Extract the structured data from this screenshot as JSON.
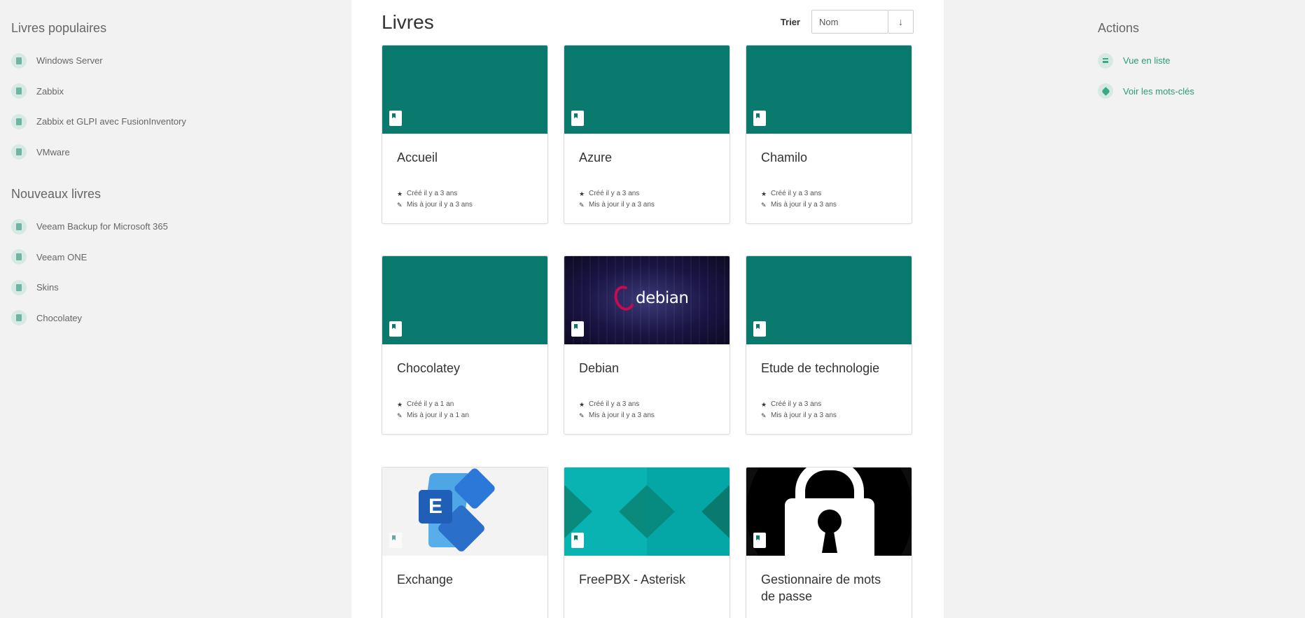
{
  "left_sidebar": {
    "popular_heading": "Livres populaires",
    "popular": [
      "Windows Server",
      "Zabbix",
      "Zabbix et GLPI avec FusionInventory",
      "VMware"
    ],
    "new_heading": "Nouveaux livres",
    "new": [
      "Veeam Backup for Microsoft 365",
      "Veeam ONE",
      "Skins",
      "Chocolatey"
    ]
  },
  "right_sidebar": {
    "heading": "Actions",
    "actions": [
      {
        "label": "Vue en liste",
        "icon": "list-icon"
      },
      {
        "label": "Voir les mots-clés",
        "icon": "tag-icon"
      }
    ]
  },
  "main": {
    "title": "Livres",
    "sort_label": "Trier",
    "sort_value": "Nom",
    "sort_direction": "↓",
    "books": [
      {
        "title": "Accueil",
        "created": "Créé il y a 3 ans",
        "updated": "Mis à jour il y a 3 ans",
        "cover": "teal"
      },
      {
        "title": "Azure",
        "created": "Créé il y a 3 ans",
        "updated": "Mis à jour il y a 3 ans",
        "cover": "teal"
      },
      {
        "title": "Chamilo",
        "created": "Créé il y a 3 ans",
        "updated": "Mis à jour il y a 3 ans",
        "cover": "teal"
      },
      {
        "title": "Chocolatey",
        "created": "Créé il y a 1 an",
        "updated": "Mis à jour il y a 1 an",
        "cover": "teal"
      },
      {
        "title": "Debian",
        "created": "Créé il y a 3 ans",
        "updated": "Mis à jour il y a 3 ans",
        "cover": "debian",
        "cover_text": "debian"
      },
      {
        "title": "Etude de technologie",
        "created": "Créé il y a 3 ans",
        "updated": "Mis à jour il y a 3 ans",
        "cover": "teal"
      },
      {
        "title": "Exchange",
        "created": "",
        "updated": "",
        "cover": "exchange",
        "cover_text": "E"
      },
      {
        "title": "FreePBX - Asterisk",
        "created": "",
        "updated": "",
        "cover": "freepbx"
      },
      {
        "title": "Gestionnaire de mots de passe",
        "created": "",
        "updated": "",
        "cover": "lock"
      }
    ]
  },
  "colors": {
    "accent": "#0a7a6e",
    "link": "#2a9d76"
  }
}
